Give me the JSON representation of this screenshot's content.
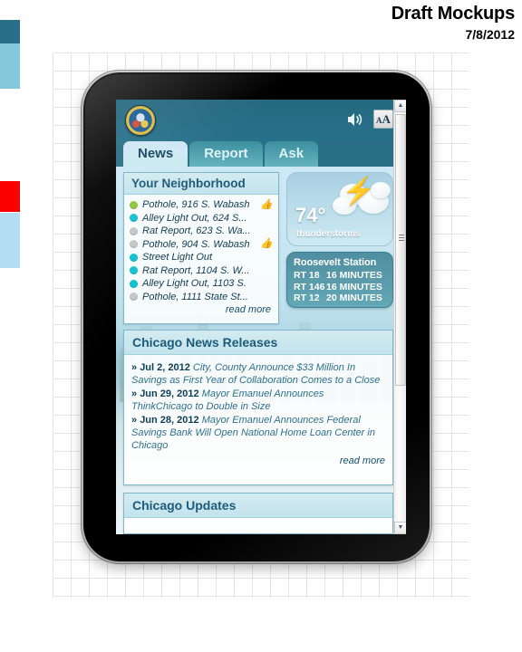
{
  "document": {
    "title": "Draft Mockups",
    "date": "7/8/2012"
  },
  "palette": {
    "swatches": [
      {
        "name": "dark-teal",
        "hex": "#2a6f89"
      },
      {
        "name": "mid-blue",
        "hex": "#86c8db"
      },
      {
        "name": "red",
        "hex": "#fc0000"
      },
      {
        "name": "pale-blue",
        "hex": "#b4ddf2"
      }
    ],
    "accent": "#1d5b7a",
    "header_bg": "#27708a",
    "tab_active_text": "#15485e"
  },
  "app": {
    "header": {
      "logo": "chicago-city-seal",
      "speaker_icon": "speaker-icon",
      "textsize_icon_large": "A",
      "textsize_icon_small": "A"
    },
    "tabs": [
      {
        "label": "News",
        "active": true
      },
      {
        "label": "Report",
        "active": false
      },
      {
        "label": "Ask",
        "active": false
      }
    ],
    "neighborhood": {
      "title": "Your Neighborhood",
      "read_more": "read more",
      "items": [
        {
          "label": "Pothole, 916 S. Wabash",
          "status": "green",
          "thumb": true
        },
        {
          "label": "Alley Light Out, 624 S...",
          "status": "cyan",
          "thumb": false
        },
        {
          "label": "Rat Report, 623 S. Wa...",
          "status": "gray",
          "thumb": false
        },
        {
          "label": "Pothole, 904 S. Wabash",
          "status": "gray",
          "thumb": true
        },
        {
          "label": "Street Light Out",
          "status": "cyan",
          "thumb": false
        },
        {
          "label": "Rat Report, 1104 S. W...",
          "status": "cyan",
          "thumb": false
        },
        {
          "label": "Alley Light Out, 1103 S.",
          "status": "cyan",
          "thumb": false
        },
        {
          "label": "Pothole, 1111 State St...",
          "status": "gray",
          "thumb": false
        }
      ],
      "status_colors": {
        "green": "#8cc63f",
        "cyan": "#13c2d4",
        "gray": "#c3c7c9"
      }
    },
    "weather": {
      "temperature": "74°",
      "condition": "thunderstorms",
      "icon": "thunderstorm-icon"
    },
    "transit": {
      "station": "Roosevelt Station",
      "routes": [
        {
          "route": "RT 18",
          "eta": "16 MINUTES"
        },
        {
          "route": "RT 146",
          "eta": "16 MINUTES"
        },
        {
          "route": "RT 12",
          "eta": "20 MINUTES"
        }
      ]
    },
    "news_releases": {
      "title": "Chicago News Releases",
      "read_more": "read more",
      "bullet": "»",
      "items": [
        {
          "date": "Jul 2, 2012",
          "headline": "City, County Announce $33 Million In Savings as First Year of Collaboration Comes to a Close"
        },
        {
          "date": "Jun 29, 2012",
          "headline": "Mayor Emanuel Announces ThinkChicago to Double in Size"
        },
        {
          "date": "Jun 28, 2012",
          "headline": "Mayor Emanuel Announces Federal Savings Bank Will Open National Home Loan Center in Chicago"
        }
      ]
    },
    "updates": {
      "title": "Chicago Updates"
    },
    "scrollbar": {
      "up_arrow": "▲",
      "down_arrow": "▼"
    }
  }
}
